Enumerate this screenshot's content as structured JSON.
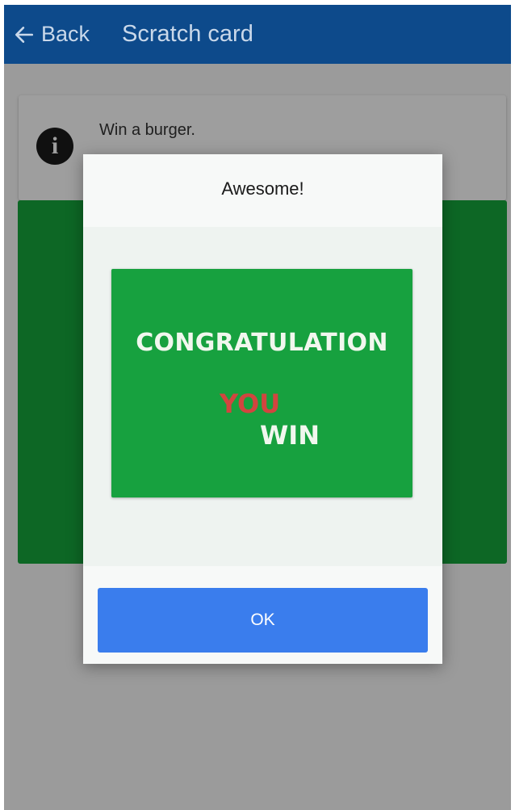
{
  "appbar": {
    "back_label": "Back",
    "title": "Scratch card",
    "back_icon": "arrow-left-icon"
  },
  "info": {
    "icon": "info-icon",
    "glyph": "i",
    "text": "Win a burger."
  },
  "dialog": {
    "title": "Awesome!",
    "card": {
      "line1": "CONGRATULATION",
      "line2": "YOU",
      "line3": "WIN"
    },
    "ok_label": "OK"
  },
  "colors": {
    "appbar": "#0d4a8b",
    "card_green": "#17a13f",
    "you_red": "#d2453f",
    "button_blue": "#3a7ded"
  }
}
